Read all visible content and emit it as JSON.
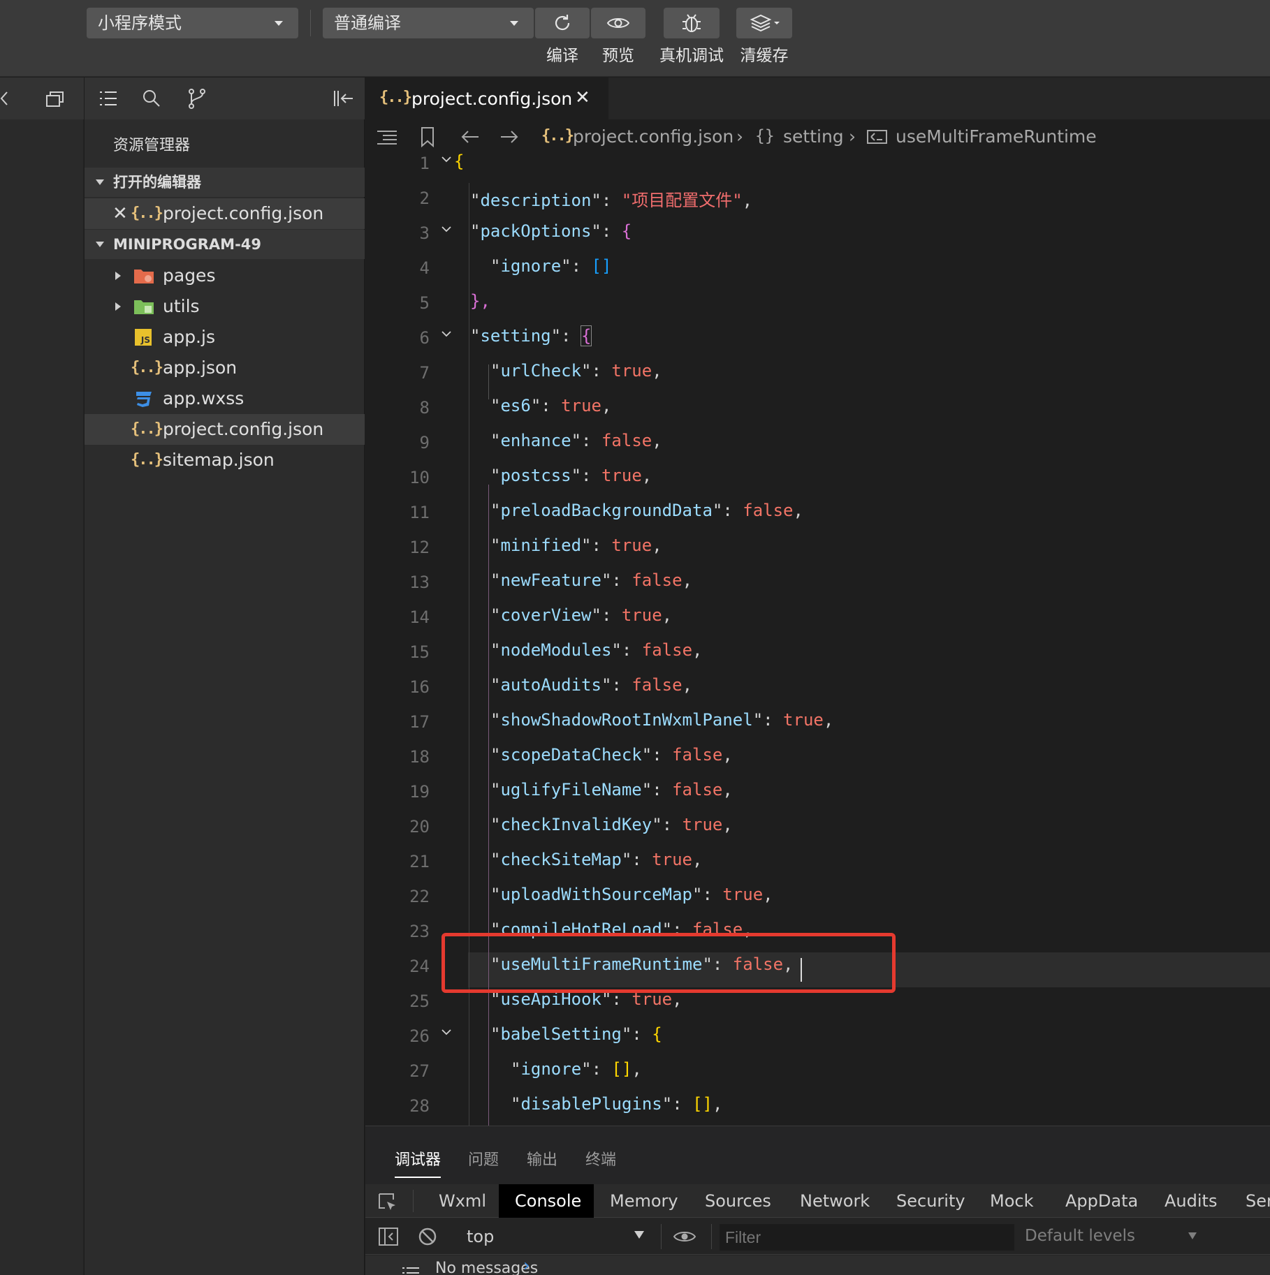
{
  "toolbar": {
    "mode_select": "小程序模式",
    "compile_select": "普通编译",
    "labels": {
      "compile": "编译",
      "preview": "预览",
      "device_debug": "真机调试",
      "clear_cache": "清缓存"
    }
  },
  "sidebar": {
    "title": "资源管理器",
    "open_editors_label": "打开的编辑器",
    "open_editors": [
      {
        "name": "project.config.json",
        "icon": "json-icon"
      }
    ],
    "project_label": "MINIPROGRAM-49",
    "files": [
      {
        "name": "pages",
        "icon": "folder-pages-icon",
        "type": "folder"
      },
      {
        "name": "utils",
        "icon": "folder-utils-icon",
        "type": "folder"
      },
      {
        "name": "app.js",
        "icon": "js-icon",
        "type": "file"
      },
      {
        "name": "app.json",
        "icon": "json-icon",
        "type": "file"
      },
      {
        "name": "app.wxss",
        "icon": "css-icon",
        "type": "file"
      },
      {
        "name": "project.config.json",
        "icon": "json-icon",
        "type": "file",
        "selected": true
      },
      {
        "name": "sitemap.json",
        "icon": "json-icon",
        "type": "file"
      }
    ]
  },
  "editor": {
    "tab_label": "project.config.json",
    "breadcrumb": {
      "file": "project.config.json",
      "section": "setting",
      "key": "useMultiFrameRuntime"
    },
    "highlighted_line": 24,
    "lines": [
      {
        "n": "1",
        "text": "{"
      },
      {
        "n": "2",
        "key": "description",
        "value": "项目配置文件",
        "kind": "string"
      },
      {
        "n": "3",
        "key": "packOptions",
        "value": "{",
        "kind": "open"
      },
      {
        "n": "4",
        "key": "ignore",
        "value": "[]",
        "kind": "array"
      },
      {
        "n": "5",
        "text": "},"
      },
      {
        "n": "6",
        "key": "setting",
        "value": "{",
        "kind": "open"
      },
      {
        "n": "7",
        "key": "urlCheck",
        "value": "true",
        "kind": "bool"
      },
      {
        "n": "8",
        "key": "es6",
        "value": "true",
        "kind": "bool"
      },
      {
        "n": "9",
        "key": "enhance",
        "value": "false",
        "kind": "bool"
      },
      {
        "n": "10",
        "key": "postcss",
        "value": "true",
        "kind": "bool"
      },
      {
        "n": "11",
        "key": "preloadBackgroundData",
        "value": "false",
        "kind": "bool"
      },
      {
        "n": "12",
        "key": "minified",
        "value": "true",
        "kind": "bool"
      },
      {
        "n": "13",
        "key": "newFeature",
        "value": "false",
        "kind": "bool"
      },
      {
        "n": "14",
        "key": "coverView",
        "value": "true",
        "kind": "bool"
      },
      {
        "n": "15",
        "key": "nodeModules",
        "value": "false",
        "kind": "bool"
      },
      {
        "n": "16",
        "key": "autoAudits",
        "value": "false",
        "kind": "bool"
      },
      {
        "n": "17",
        "key": "showShadowRootInWxmlPanel",
        "value": "true",
        "kind": "bool"
      },
      {
        "n": "18",
        "key": "scopeDataCheck",
        "value": "false",
        "kind": "bool"
      },
      {
        "n": "19",
        "key": "uglifyFileName",
        "value": "false",
        "kind": "bool"
      },
      {
        "n": "20",
        "key": "checkInvalidKey",
        "value": "true",
        "kind": "bool"
      },
      {
        "n": "21",
        "key": "checkSiteMap",
        "value": "true",
        "kind": "bool"
      },
      {
        "n": "22",
        "key": "uploadWithSourceMap",
        "value": "true",
        "kind": "bool"
      },
      {
        "n": "23",
        "key": "compileHotReLoad",
        "value": "false",
        "kind": "bool"
      },
      {
        "n": "24",
        "key": "useMultiFrameRuntime",
        "value": "false",
        "kind": "bool"
      },
      {
        "n": "25",
        "key": "useApiHook",
        "value": "true",
        "kind": "bool"
      },
      {
        "n": "26",
        "key": "babelSetting",
        "value": "{",
        "kind": "open"
      },
      {
        "n": "27",
        "key": "ignore",
        "value": "[]",
        "kind": "array"
      },
      {
        "n": "28",
        "key": "disablePlugins",
        "value": "[]",
        "kind": "array"
      }
    ]
  },
  "panel": {
    "tabs": [
      "调试器",
      "问题",
      "输出",
      "终端"
    ],
    "devtools_tabs": [
      "Wxml",
      "Console",
      "Memory",
      "Sources",
      "Network",
      "Security",
      "Mock",
      "AppData",
      "Audits",
      "Ser"
    ],
    "active_devtools_tab": "Console",
    "context": "top",
    "filter_placeholder": "Filter",
    "levels": "Default levels",
    "messages": "No messages"
  },
  "colors": {
    "highlight_box": "#e53a2f",
    "string": "#f06d6d",
    "key": "#9cdcfe",
    "bool": "#f27466"
  }
}
